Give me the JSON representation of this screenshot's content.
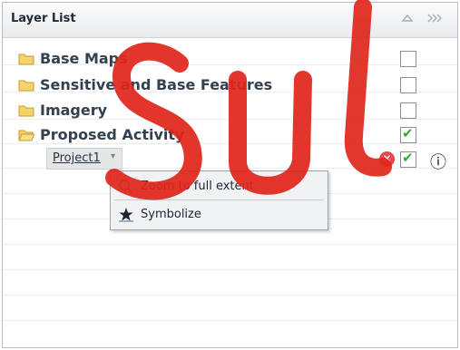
{
  "panel": {
    "title": "Layer List",
    "header_icons": [
      "collapse-up-icon",
      "double-chevron-right-icon"
    ]
  },
  "layers": [
    {
      "label": "Base Maps",
      "checked": false,
      "expanded": false
    },
    {
      "label": "Sensitive and Base Features",
      "checked": false,
      "expanded": false
    },
    {
      "label": "Imagery",
      "checked": false,
      "expanded": false
    },
    {
      "label": "Proposed Activity",
      "checked": true,
      "expanded": true
    }
  ],
  "sublayer": {
    "label": "Project1",
    "caret": "▾",
    "checked": true,
    "remove_icon": "remove-icon",
    "info_icon": "info-icon"
  },
  "context_menu": {
    "items": [
      {
        "label": "Zoom to full extent",
        "icon": "zoom-extent-icon"
      },
      {
        "label": "Symbolize",
        "icon": "symbolize-icon"
      }
    ]
  },
  "colors": {
    "folder_fill": "#f5d36b",
    "folder_stroke": "#c99a2c",
    "check_green": "#3aa534",
    "remove_red": "#e24b4b",
    "watermark_red": "#e0261b"
  }
}
